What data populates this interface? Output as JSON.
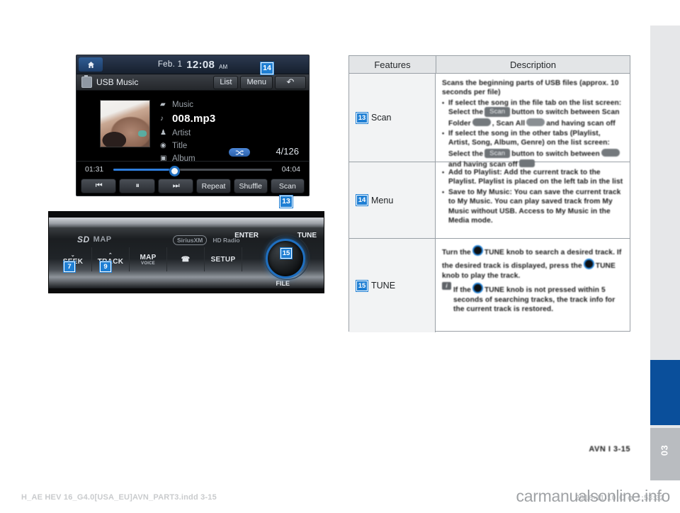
{
  "head_unit": {
    "status_bar": {
      "home_icon": "home-icon",
      "date": "Feb.  1",
      "time": "12:08",
      "meridiem": "AM"
    },
    "menu_bar": {
      "source_icon": "usb-icon",
      "source_label": "USB Music",
      "list_label": "List",
      "menu_label": "Menu",
      "back_icon": "back-arrow-icon",
      "back_glyph": "↶"
    },
    "now_playing": {
      "album_art": "album-art-thumbnail",
      "rows": [
        {
          "icon": "folder-icon",
          "glyph": "▰",
          "text": "Music"
        },
        {
          "icon": "note-icon",
          "glyph": "♪",
          "text": "008.mp3"
        },
        {
          "icon": "artist-icon",
          "glyph": "♟",
          "text": "Artist"
        },
        {
          "icon": "title-icon",
          "glyph": "◉",
          "text": "Title"
        },
        {
          "icon": "album-icon",
          "glyph": "▣",
          "text": "Album"
        }
      ],
      "shuffle_indicator": "shuffle-icon",
      "track_count": "4/126",
      "elapsed_time": "01:31",
      "total_time": "04:04",
      "progress_percent": 37
    },
    "transport": [
      {
        "name": "previous-track-button",
        "label": "⏮"
      },
      {
        "name": "pause-button",
        "label": "⏸"
      },
      {
        "name": "next-track-button",
        "label": "⏭"
      },
      {
        "name": "repeat-button",
        "label": "Repeat"
      },
      {
        "name": "shuffle-button",
        "label": "Shuffle"
      },
      {
        "name": "scan-button",
        "label": "Scan"
      }
    ],
    "callouts": {
      "menu": "14",
      "scan": "13"
    }
  },
  "control_panel": {
    "sd_map_label": "MAP",
    "sd_logo": "SD",
    "logo_siriusxm": "SiriusXM",
    "logo_hdradio": "HD Radio",
    "buttons": [
      {
        "name": "seek-button",
        "caret": "⌄",
        "label": "SEEK",
        "sub": ""
      },
      {
        "name": "track-button",
        "caret": "⌃",
        "label": "TRACK",
        "sub": ""
      },
      {
        "name": "map-voice-button",
        "caret": "",
        "label": "MAP",
        "sub": "VOICE"
      },
      {
        "name": "phone-button",
        "caret": "",
        "label": "☎",
        "sub": ""
      },
      {
        "name": "setup-button",
        "caret": "",
        "label": "SETUP",
        "sub": ""
      }
    ],
    "knob_label_enter": "ENTER",
    "knob_label_tune": "TUNE",
    "knob_label_file": "FILE",
    "callouts": {
      "seek": "7",
      "track": "9",
      "knob": "15"
    }
  },
  "table": {
    "header": {
      "features": "Features",
      "description": "Description"
    },
    "rows": [
      {
        "callout": "13",
        "feature": "Scan",
        "lead": "Scans the beginning parts of USB files (approx. 10 seconds per file)",
        "bullets": [
          "If select the song in the file tab on the list screen: Select the [Scan] button to switch between Scan Folder, Scan All and having scan off",
          "If select the song in the other tabs (Playlist, Artist, Song, Album, Genre) on the list screen: Select the [Scan] button to switch between scan on and having scan off"
        ]
      },
      {
        "callout": "14",
        "feature": "Menu",
        "lead": "",
        "bullets": [
          "Add to Playlist: Add the current track to the Playlist. Playlist is placed on the left tab in the list",
          "Save to My Music: You can save the current track to My Music. You can play saved track from My Music without USB. Access to My Music in the Media mode."
        ]
      },
      {
        "callout": "15",
        "feature": "TUNE",
        "lead": "Turn the TUNE knob to search a desired track. If the desired track is displayed, press the TUNE knob to play the track.",
        "bullets": [
          "If the TUNE knob is not pressed within 5 seconds of searching tracks, the track info for the current track is restored."
        ]
      }
    ]
  },
  "page": {
    "chapter_number": "03",
    "page_marker": "AVN I 3-15",
    "footer_left": "H_AE HEV 16_G4.0[USA_EU]AVN_PART3.indd   3-15",
    "footer_right": "2016-11-10   Ｏｏ 1:53:32",
    "watermark": "carmanualsonline.info"
  },
  "colors": {
    "accent_blue": "#1f7fd4",
    "chapter_blue": "#0a4f9b",
    "table_header": "#e3e5e7",
    "feature_cell": "#f2f3f4"
  }
}
